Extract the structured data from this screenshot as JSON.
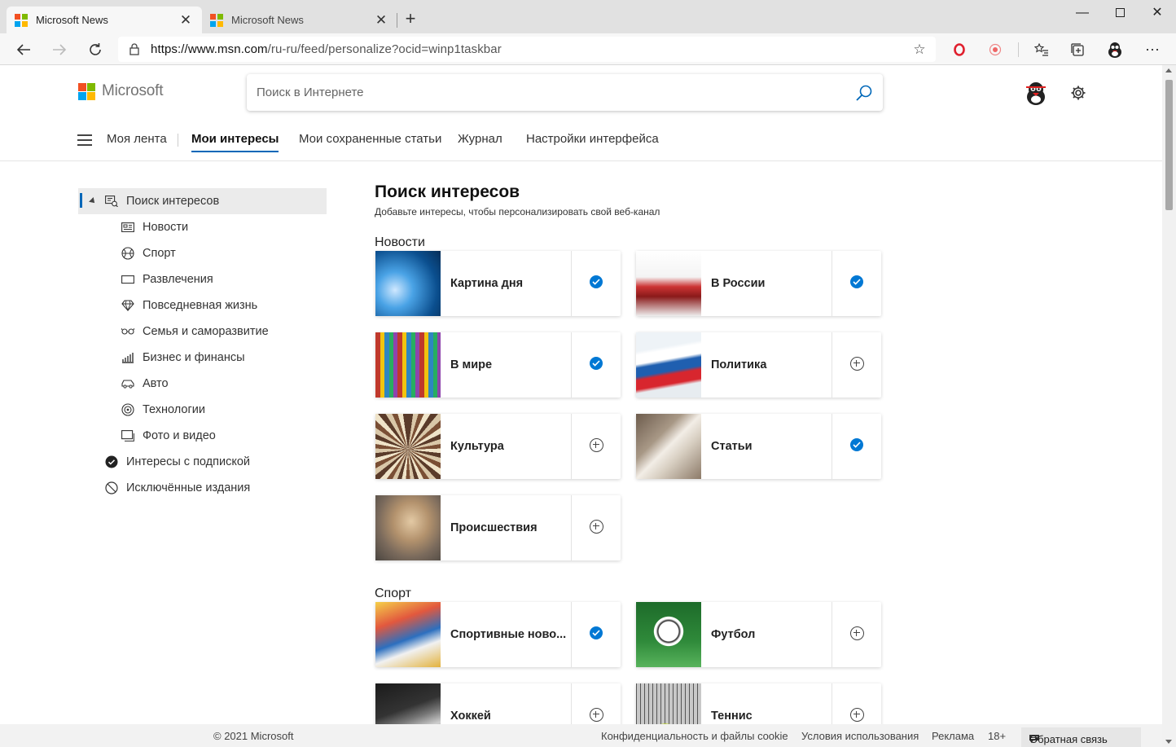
{
  "browser": {
    "tabs": [
      {
        "title": "Microsoft News",
        "active": true
      },
      {
        "title": "Microsoft News",
        "active": false
      }
    ],
    "url_prefix": "https://www.msn.com",
    "url_path": "/ru-ru/feed/personalize?ocid=winp1taskbar"
  },
  "header": {
    "brand": "Microsoft",
    "search_placeholder": "Поиск в Интернете"
  },
  "nav": {
    "items": [
      "Моя лента",
      "Мои интересы",
      "Мои сохраненные статьи",
      "Журнал",
      "Настройки интерфейса"
    ],
    "active": "Мои интересы"
  },
  "sidebar": {
    "root": "Поиск интересов",
    "children": [
      "Новости",
      "Спорт",
      "Развлечения",
      "Повседневная жизнь",
      "Семья и саморазвитие",
      "Бизнес и финансы",
      "Авто",
      "Технологии",
      "Фото и видео"
    ],
    "followed": "Интересы с подпиской",
    "blocked": "Исключённые издания"
  },
  "main": {
    "title": "Поиск интересов",
    "subtitle": "Добавьте интересы, чтобы персонализировать свой веб-канал",
    "sections": [
      {
        "name": "Новости",
        "cards": [
          {
            "label": "Картина дня",
            "followed": true
          },
          {
            "label": "В России",
            "followed": true
          },
          {
            "label": "В мире",
            "followed": true
          },
          {
            "label": "Политика",
            "followed": false
          },
          {
            "label": "Культура",
            "followed": false
          },
          {
            "label": "Статьи",
            "followed": true
          },
          {
            "label": "Происшествия",
            "followed": false
          }
        ]
      },
      {
        "name": "Спорт",
        "cards": [
          {
            "label": "Спортивные ново...",
            "followed": true
          },
          {
            "label": "Футбол",
            "followed": false
          },
          {
            "label": "Хоккей",
            "followed": false
          },
          {
            "label": "Теннис",
            "followed": false
          }
        ]
      }
    ]
  },
  "footer": {
    "copyright": "© 2021 Microsoft",
    "privacy": "Конфиденциальность и файлы cookie",
    "terms": "Условия использования",
    "ads": "Реклама",
    "age": "18+",
    "feedback": "Обратная связь"
  },
  "colors": {
    "accent": "#0067b8",
    "check": "#0078d4"
  }
}
